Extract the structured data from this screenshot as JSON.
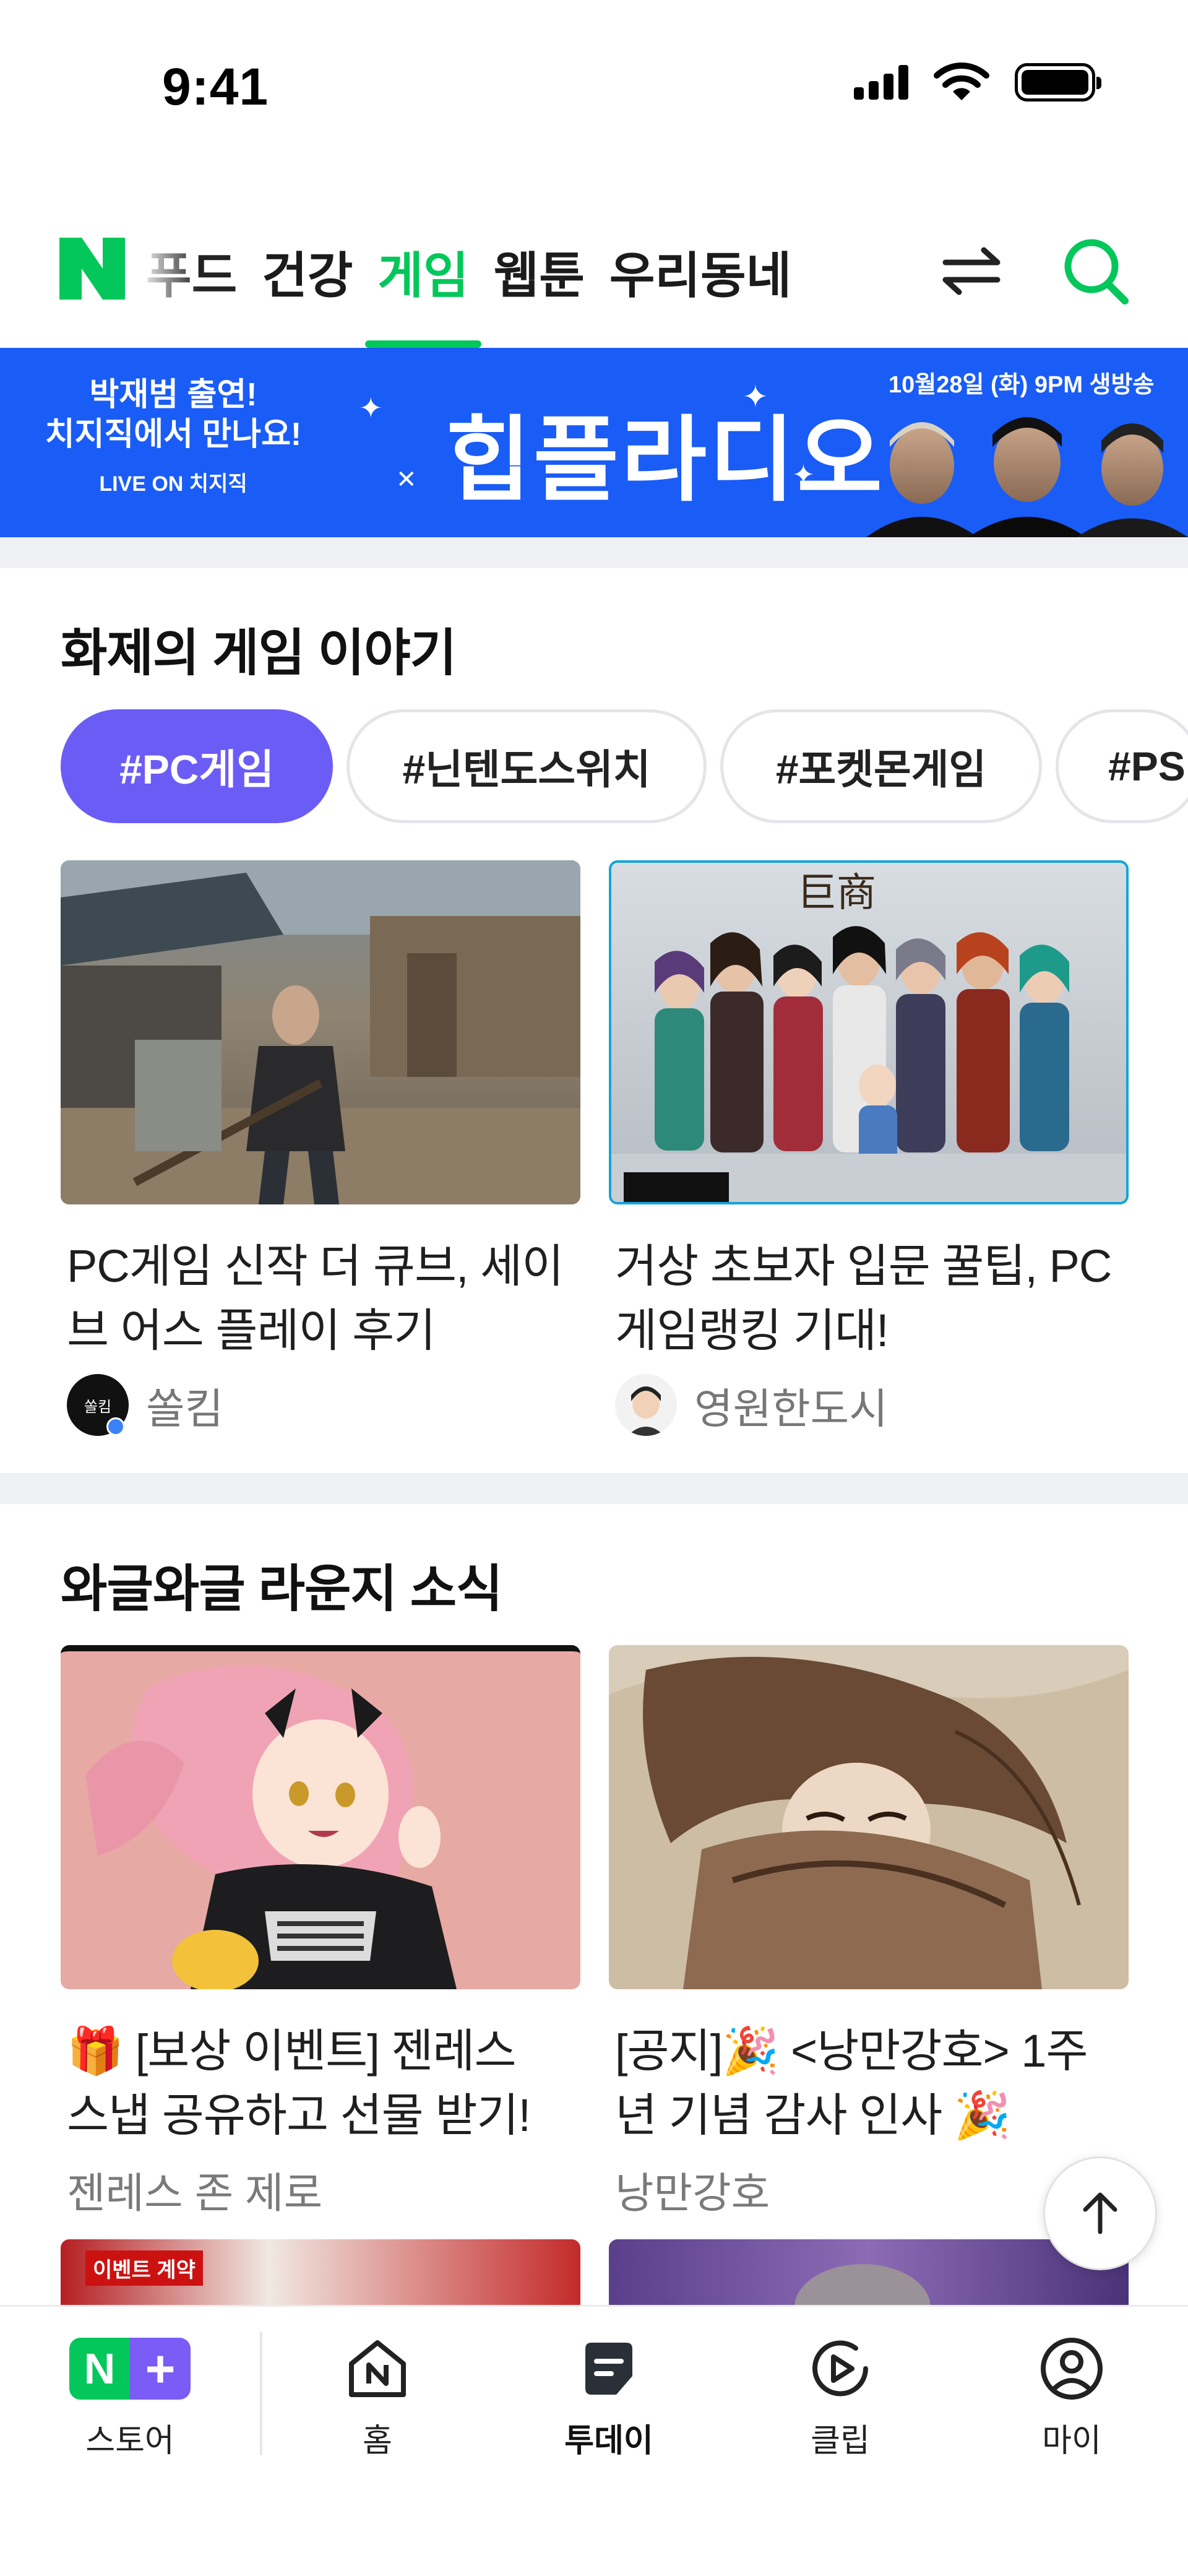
{
  "status_bar": {
    "time": "9:41"
  },
  "top_nav": {
    "tabs": [
      {
        "label": "푸드",
        "state": "partial"
      },
      {
        "label": "건강",
        "state": "normal"
      },
      {
        "label": "게임",
        "state": "active"
      },
      {
        "label": "웹툰",
        "state": "normal"
      },
      {
        "label": "우리동네",
        "state": "normal"
      }
    ],
    "accent_color": "#03c75a"
  },
  "banner": {
    "left_line1": "박재범 출연!",
    "left_line2": "치지직에서 만나요!",
    "live_on": "LIVE ON 치지직",
    "center_title": "힙플라디오",
    "date": "10월28일 (화) 9PM 생방송",
    "background_color": "#1a5cf6"
  },
  "section_games": {
    "title": "화제의 게임 이야기",
    "chips": [
      "#PC게임",
      "#닌텐도스위치",
      "#포켓몬게임",
      "#PS"
    ],
    "active_chip_color": "#6c5cf6",
    "cards": [
      {
        "title_line1": "PC게임 신작 더 큐브, 세이",
        "title_line2": "브 어스 플레이 후기",
        "author": "쏠킴",
        "avatar_text": "쏠킴"
      },
      {
        "title_line1": "거상 초보자 입문 꿀팁, PC",
        "title_line2": "게임랭킹 기대!",
        "author": "영원한도시"
      }
    ]
  },
  "section_lounge": {
    "title": "와글와글 라운지 소식",
    "cards": [
      {
        "title_line1": "🎁 [보상 이벤트] 젠레스",
        "title_line2": "스냅 공유하고 선물 받기!",
        "source": "젠레스 존 제로"
      },
      {
        "title_line1": "[공지]🎉 <낭만강호> 1주",
        "title_line2": "년 기념 감사 인사 🎉",
        "source": "낭만강호"
      }
    ],
    "next_row_thumbnail_text": "이벤트 계약"
  },
  "bottom_nav": {
    "items": [
      {
        "label": "스토어",
        "icon": "store-icon"
      },
      {
        "label": "홈",
        "icon": "home-icon"
      },
      {
        "label": "투데이",
        "icon": "today-icon",
        "active": true
      },
      {
        "label": "클립",
        "icon": "clip-icon"
      },
      {
        "label": "마이",
        "icon": "profile-icon"
      }
    ],
    "store_badge_letter": "N",
    "store_badge_plus": "+"
  }
}
